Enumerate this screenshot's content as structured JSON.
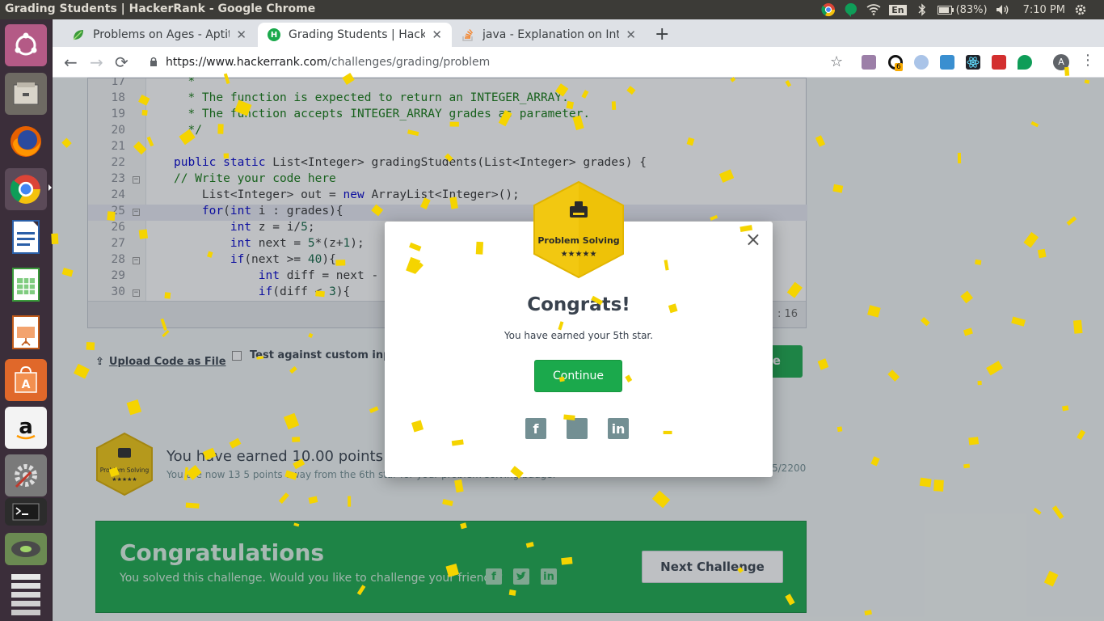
{
  "os": {
    "window_title": "Grading Students | HackerRank - Google Chrome",
    "language_indicator": "En",
    "battery": "(83%)",
    "clock": "7:10 PM"
  },
  "launcher": {
    "items": [
      "ubuntu-dash",
      "files",
      "firefox",
      "chrome",
      "writer",
      "calc",
      "impress",
      "software-center",
      "amazon",
      "system-settings",
      "terminal",
      "disks",
      "workspaces"
    ]
  },
  "browser": {
    "tabs": [
      {
        "label": "Problems on Ages - Aptitu",
        "favicon": "leaf-icon"
      },
      {
        "label": "Grading Students | Hacke",
        "favicon": "hackerrank-icon"
      },
      {
        "label": "java - Explanation on Inte",
        "favicon": "stackoverflow-icon"
      }
    ],
    "url_host": "https://www.hackerrank.com",
    "url_path": "/challenges/grading/problem",
    "extensions_badge": "6",
    "profile_initial": "A"
  },
  "editor": {
    "lines": [
      {
        "n": "17",
        "text": "  *"
      },
      {
        "n": "18",
        "text": "  * The function is expected to return an INTEGER_ARRAY."
      },
      {
        "n": "19",
        "text": "  * The function accepts INTEGER_ARRAY grades as parameter."
      },
      {
        "n": "20",
        "text": "  */"
      },
      {
        "n": "21",
        "text": ""
      },
      {
        "n": "22",
        "text": "public static List<Integer> gradingStudents(List<Integer> grades) {"
      },
      {
        "n": "23",
        "text": "// Write your code here"
      },
      {
        "n": "24",
        "text": "    List<Integer> out = new ArrayList<Integer>();"
      },
      {
        "n": "25",
        "text": "    for(int i : grades){"
      },
      {
        "n": "26",
        "text": "        int z = i/5;"
      },
      {
        "n": "27",
        "text": "        int next = 5*(z+1);"
      },
      {
        "n": "28",
        "text": "        if(next >= 40){"
      },
      {
        "n": "29",
        "text": "            int diff = next -"
      },
      {
        "n": "30",
        "text": "            if(diff < 3){"
      }
    ],
    "cursor_position": ": 16"
  },
  "actions": {
    "upload_label": "Upload Code as File",
    "custom_input_label": "Test against custom input",
    "submit_label": "de"
  },
  "points": {
    "badge_label": "Problem Solving",
    "badge_stars": "★★★★★",
    "title": "You have earned 10.00 points!",
    "subtitle": "You are now 13  5 points away from the 6th star for your problem solving badge.",
    "score": "5/2200"
  },
  "banner": {
    "title": "Congratulations",
    "subtitle": "You solved this challenge. Would you like to challenge your friends?",
    "next_label": "Next Challenge"
  },
  "modal": {
    "badge_label": "Problem Solving",
    "badge_stars": "★★★★★",
    "title": "Congrats!",
    "subtitle": "You have earned your 5th star.",
    "continue_label": "Continue",
    "close_glyph": "×"
  },
  "colors": {
    "accent_green": "#1ba94c",
    "badge_gold": "#f2c811",
    "confetti": "#f5d400"
  }
}
